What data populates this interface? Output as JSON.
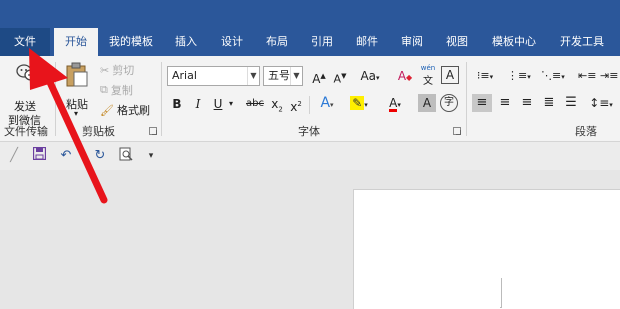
{
  "tabs": [
    {
      "label": "文件"
    },
    {
      "label": "开始"
    },
    {
      "label": "我的模板"
    },
    {
      "label": "插入"
    },
    {
      "label": "设计"
    },
    {
      "label": "布局"
    },
    {
      "label": "引用"
    },
    {
      "label": "邮件"
    },
    {
      "label": "审阅"
    },
    {
      "label": "视图"
    },
    {
      "label": "模板中心"
    },
    {
      "label": "开发工具"
    }
  ],
  "ribbon": {
    "wechat": {
      "line1": "发送",
      "line2": "到微信",
      "group": "文件传输"
    },
    "clipboard": {
      "paste": "粘贴",
      "cut": "剪切",
      "copy": "复制",
      "format_painter": "格式刷",
      "group": "剪贴板"
    },
    "font": {
      "name": "Arial",
      "size": "五号",
      "group": "字体",
      "phonetic_top": "wén",
      "phonetic_bottom": "文"
    },
    "paragraph": {
      "group": "段落"
    }
  },
  "colors": {
    "accent": "#2b579a",
    "annotation_arrow": "#e8141b"
  }
}
